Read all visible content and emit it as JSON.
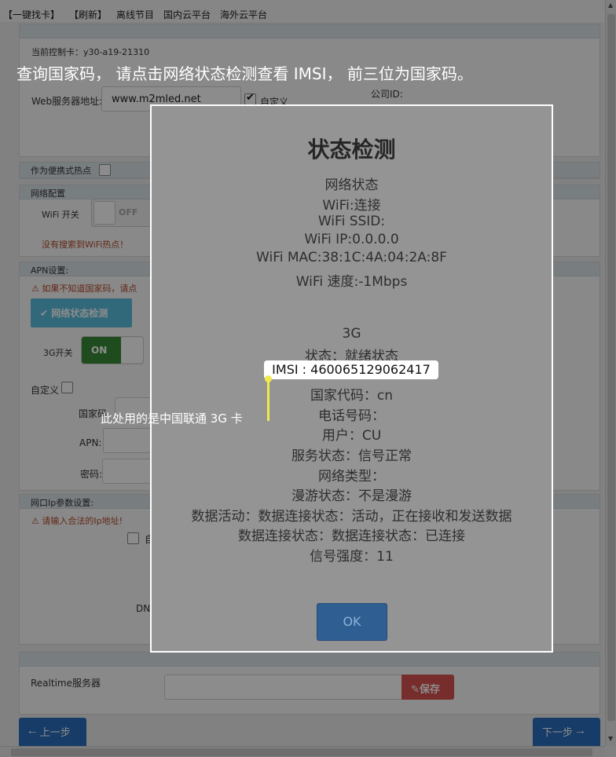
{
  "topnav": {
    "items": [
      "【一键找卡】",
      "【刷新】",
      "离线节目",
      "国内云平台",
      "海外云平台"
    ]
  },
  "controller": {
    "label": "当前控制卡：y30-a19-21310"
  },
  "server": {
    "web_label": "Web服务器地址:",
    "web_value": "www.m2mled.net",
    "custom_label": "自定义",
    "company_label": "公司ID:"
  },
  "hotspot": {
    "label": "作为便携式热点"
  },
  "network": {
    "header": "网络配置",
    "wifi_label": "WiFi 开关",
    "wifi_state": "OFF",
    "no_wifi": "没有搜索到WiFi热点！"
  },
  "apn": {
    "header": "APN设置:",
    "warning": "如果不知道国家码，请点",
    "check_button": "网络状态检测",
    "g3_label": "3G开关",
    "g3_state": "ON",
    "custom_label": "自定义",
    "country_label": "国家码",
    "apn_label": "APN:",
    "password_label": "密码:"
  },
  "ip": {
    "header": "网口Ip参数设置:",
    "warning": "请输入合法的Ip地址!",
    "auto_label": "自",
    "dns_label": "DN"
  },
  "realtime": {
    "label": "Realtime服务器",
    "save_button": "保存"
  },
  "footer": {
    "prev_button": "上一步",
    "next_button": "下一步"
  },
  "modal": {
    "title": "状态检测",
    "lines": [
      "网络状态",
      "WiFi:连接",
      "WiFi SSID:",
      "WiFi IP:0.0.0.0",
      "WiFi MAC:38:1C:4A:04:2A:8F",
      "WiFi 速度:-1Mbps",
      "3G",
      "状态：就绪状态",
      "国家代码：cn",
      "电话号码：",
      "用户：CU",
      "服务状态：信号正常",
      "网络类型：",
      "漫游状态：不是漫游",
      "数据活动：数据连接状态：活动，正在接收和发送数据",
      "数据连接状态：数据连接状态：已连接",
      "信号强度：11"
    ],
    "ok_button": "OK"
  },
  "annotations": {
    "caption": "查询国家码，  请点击网络状态检测查看 IMSI，  前三位为国家码。",
    "imsi": "IMSI : 460065129062417",
    "note": "此处用的是中国联通 3G 卡"
  },
  "colors": {
    "info_button": "#5bc0de",
    "nav_button": "#2a6ebd",
    "save_button": "#d9534f",
    "highlight": "#f2e94e"
  }
}
